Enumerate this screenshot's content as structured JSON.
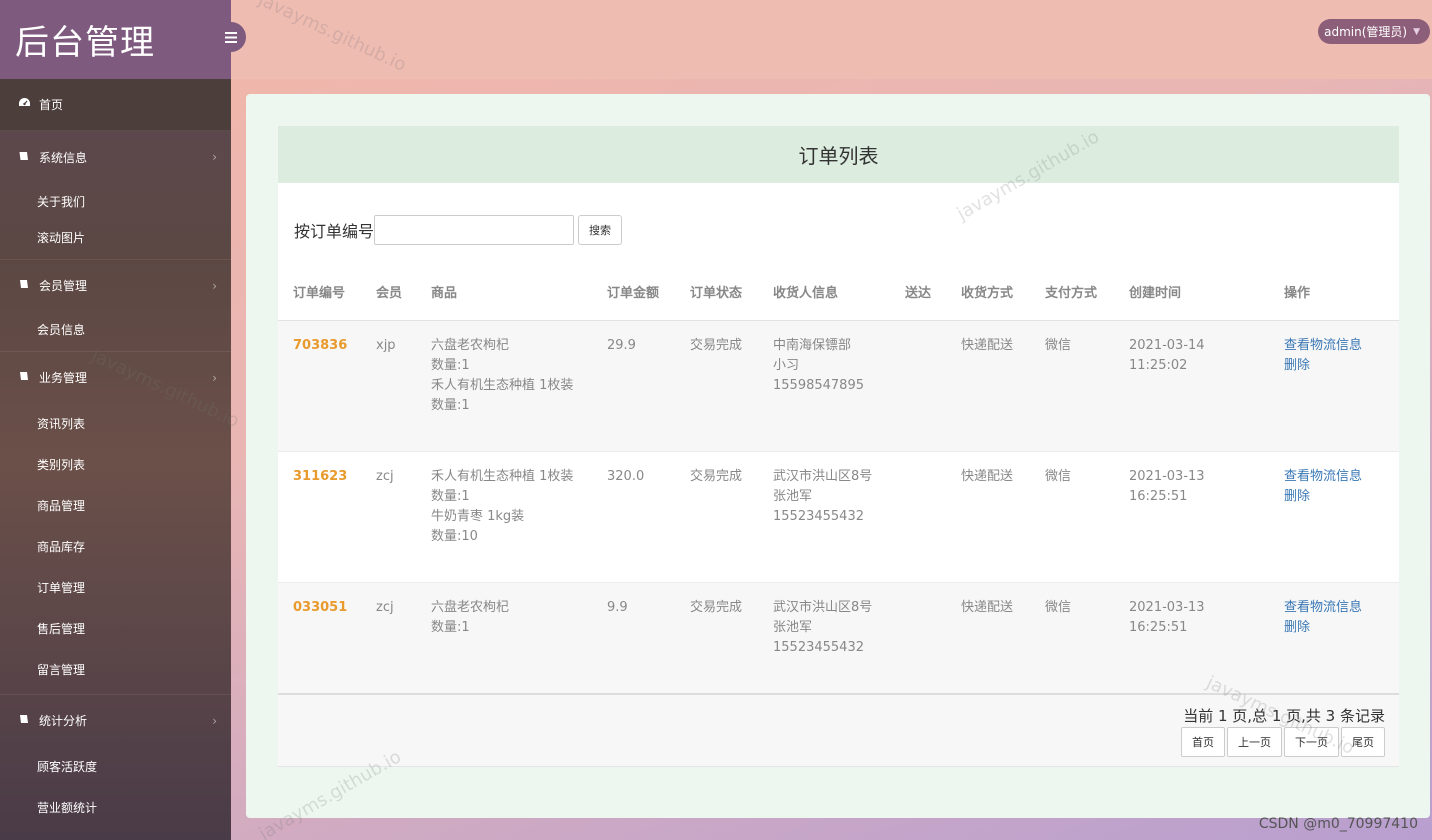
{
  "brand": {
    "title": "后台管理",
    "toggle_icon": "bars-icon"
  },
  "user": {
    "label": "admin(管理员)"
  },
  "nav": {
    "home": "首页",
    "groups": [
      {
        "label": "系统信息",
        "icon": "book-icon",
        "items": [
          "关于我们",
          "滚动图片"
        ]
      },
      {
        "label": "会员管理",
        "icon": "book-icon",
        "items": [
          "会员信息"
        ]
      },
      {
        "label": "业务管理",
        "icon": "book-icon",
        "items": [
          "资讯列表",
          "类别列表",
          "商品管理",
          "商品库存",
          "订单管理",
          "售后管理",
          "留言管理"
        ]
      },
      {
        "label": "统计分析",
        "icon": "book-icon",
        "items": [
          "顾客活跃度",
          "营业额统计"
        ]
      }
    ]
  },
  "page": {
    "title": "订单列表",
    "search_label": "按订单编号",
    "search_value": "",
    "search_button": "搜索"
  },
  "table": {
    "headers": [
      "订单编号",
      "会员",
      "商品",
      "订单金额",
      "订单状态",
      "收货人信息",
      "送达",
      "收货方式",
      "支付方式",
      "创建时间",
      "操作"
    ],
    "rows": [
      {
        "order_no": "703836",
        "member": "xjp",
        "goods": [
          "六盘老农枸杞",
          "数量:1",
          "禾人有机生态种植 1枚装",
          "数量:1"
        ],
        "amount": "29.9",
        "status": "交易完成",
        "receiver": [
          "中南海保镖部",
          "小习",
          "15598547895"
        ],
        "delivered": "",
        "ship_method": "快递配送",
        "pay_method": "微信",
        "created": "2021-03-14 11:25:02",
        "ops": [
          "查看物流信息",
          "删除"
        ]
      },
      {
        "order_no": "311623",
        "member": "zcj",
        "goods": [
          "禾人有机生态种植 1枚装",
          "数量:1",
          "牛奶青枣 1kg装",
          "数量:10"
        ],
        "amount": "320.0",
        "status": "交易完成",
        "receiver": [
          "武汉市洪山区8号",
          "张池军",
          "15523455432"
        ],
        "delivered": "",
        "ship_method": "快递配送",
        "pay_method": "微信",
        "created": "2021-03-13 16:25:51",
        "ops": [
          "查看物流信息",
          "删除"
        ]
      },
      {
        "order_no": "033051",
        "member": "zcj",
        "goods": [
          "六盘老农枸杞",
          "数量:1"
        ],
        "amount": "9.9",
        "status": "交易完成",
        "receiver": [
          "武汉市洪山区8号",
          "张池军",
          "15523455432"
        ],
        "delivered": "",
        "ship_method": "快递配送",
        "pay_method": "微信",
        "created": "2021-03-13 16:25:51",
        "ops": [
          "查看物流信息",
          "删除"
        ]
      }
    ]
  },
  "pagination": {
    "info": "当前 1 页,总 1 页,共 3 条记录",
    "buttons": [
      "首页",
      "上一页",
      "下一页",
      "尾页"
    ]
  },
  "watermark": "javayms.github.io",
  "credit": "CSDN @m0_70997410",
  "colors": {
    "sidebar_brand": "#7e5a7e",
    "order_no": "#e99a2c",
    "link": "#3a78b5",
    "card_header": "#dcede0"
  }
}
